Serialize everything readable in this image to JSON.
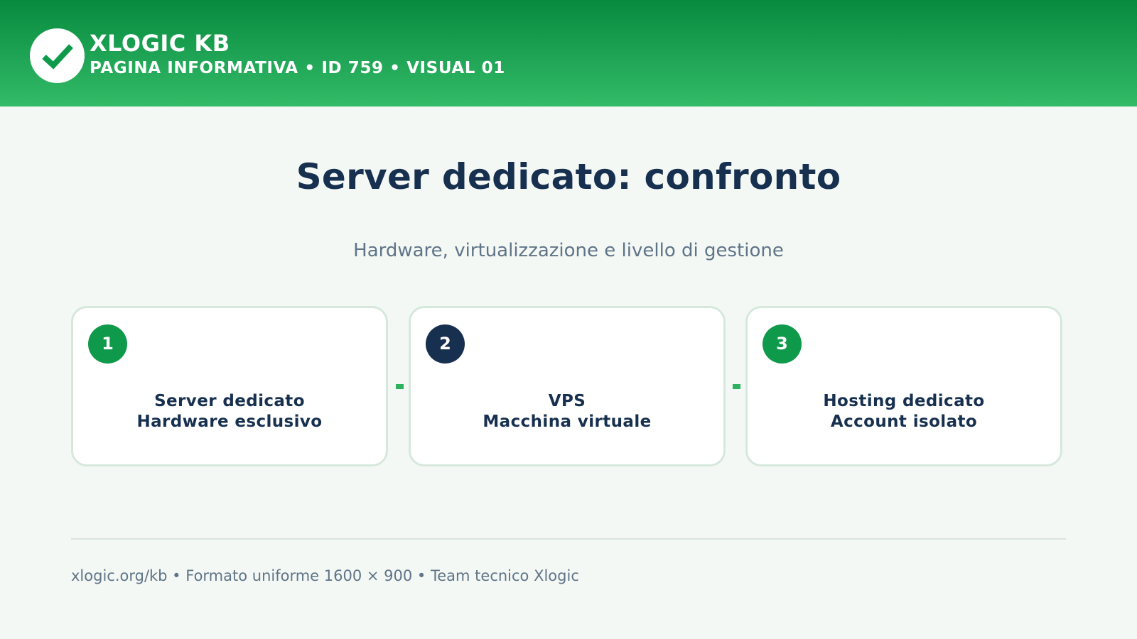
{
  "header": {
    "brand": "XLOGIC KB",
    "subtitle": "PAGINA INFORMATIVA • ID 759 • VISUAL 01",
    "logo_icon": "checkmark-icon"
  },
  "main": {
    "title": "Server dedicato: confronto",
    "subtitle": "Hardware, virtualizzazione e livello di gestione"
  },
  "cards": [
    {
      "number": "1",
      "line1": "Server dedicato",
      "line2": "Hardware esclusivo",
      "badge_color": "#0f9a4b"
    },
    {
      "number": "2",
      "line1": "VPS",
      "line2": "Macchina virtuale",
      "badge_color": "#17304f"
    },
    {
      "number": "3",
      "line1": "Hosting dedicato",
      "line2": "Account isolato",
      "badge_color": "#0f9a4b"
    }
  ],
  "footer": {
    "text": "xlogic.org/kb • Formato uniforme 1600 × 900 • Team tecnico Xlogic"
  },
  "colors": {
    "header_top": "#078a3e",
    "header_bottom": "#33bb68",
    "navy": "#17304f",
    "green": "#0f9a4b",
    "muted_text": "#5f7487",
    "background": "#f4f8f5"
  }
}
